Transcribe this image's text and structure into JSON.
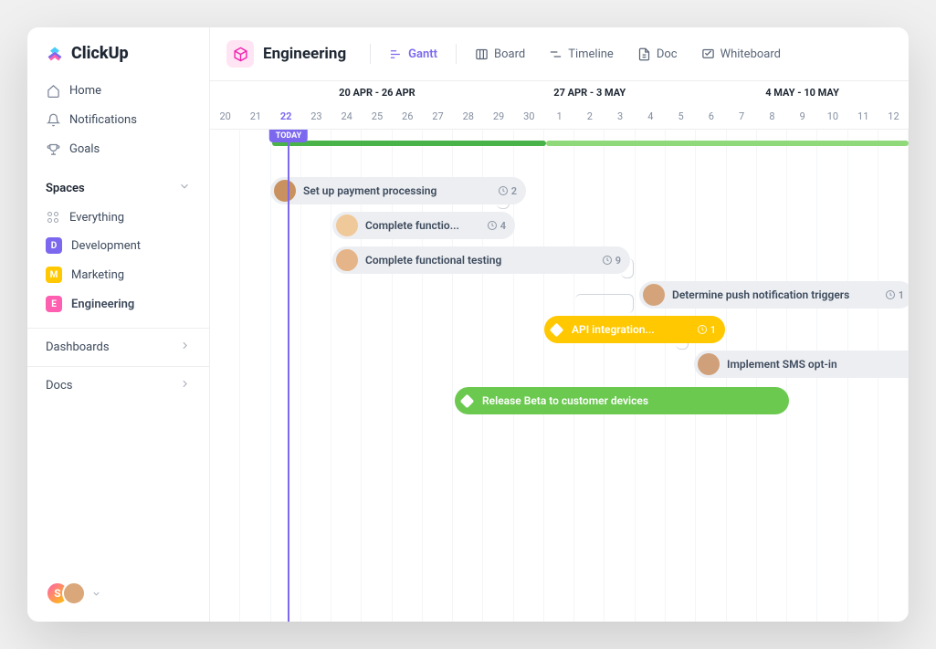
{
  "brand": "ClickUp",
  "nav": {
    "home": "Home",
    "notifications": "Notifications",
    "goals": "Goals"
  },
  "spaces_header": "Spaces",
  "spaces": {
    "everything": "Everything",
    "development": {
      "label": "Development",
      "letter": "D",
      "color": "#7b68ee"
    },
    "marketing": {
      "label": "Marketing",
      "letter": "M",
      "color": "#ffc800"
    },
    "engineering": {
      "label": "Engineering",
      "letter": "E",
      "color": "#ff5fb0"
    }
  },
  "sections": {
    "dashboards": "Dashboards",
    "docs": "Docs"
  },
  "header": {
    "title": "Engineering",
    "views": {
      "gantt": "Gantt",
      "board": "Board",
      "timeline": "Timeline",
      "doc": "Doc",
      "whiteboard": "Whiteboard"
    }
  },
  "timeline": {
    "weeks": [
      {
        "label": "20 APR - 26 APR",
        "span": 7,
        "offset": 2
      },
      {
        "label": "27 APR - 3 MAY",
        "span": 7,
        "offset": 0
      },
      {
        "label": "4 MAY - 10 MAY",
        "span": 7,
        "offset": 0
      }
    ],
    "days": [
      "20",
      "21",
      "22",
      "23",
      "24",
      "25",
      "26",
      "27",
      "28",
      "29",
      "30",
      "1",
      "2",
      "3",
      "4",
      "5",
      "6",
      "7",
      "8",
      "9",
      "10",
      "11",
      "12"
    ],
    "today_index": 2,
    "today_label": "TODAY"
  },
  "tasks": [
    {
      "label": "Set up payment processing",
      "count": "2"
    },
    {
      "label": "Complete functio...",
      "count": "4"
    },
    {
      "label": "Complete functional testing",
      "count": "9"
    },
    {
      "label": "Determine push notification triggers",
      "count": "1"
    },
    {
      "label": "API integration...",
      "count": "1"
    },
    {
      "label": "Implement SMS opt-in",
      "count": ""
    },
    {
      "label": "Release Beta to customer devices",
      "count": ""
    }
  ],
  "footer_user_letter": "S"
}
